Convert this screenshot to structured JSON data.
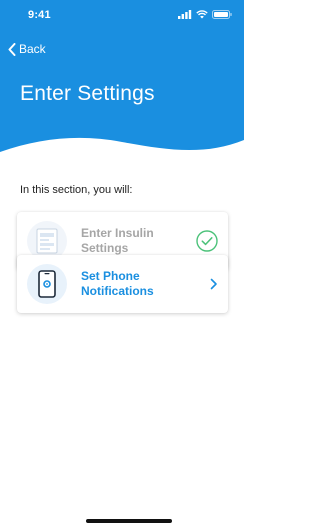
{
  "status_bar": {
    "time": "9:41"
  },
  "nav": {
    "back_label": "Back"
  },
  "header": {
    "title": "Enter Settings"
  },
  "intro_text": "In this section, you will:",
  "steps": [
    {
      "label_line1": "Enter Insulin",
      "label_line2": "Settings",
      "state": "completed",
      "icon": "document-form-icon",
      "trail_icon": "checkmark-circle-icon"
    },
    {
      "label_line1": "Set Phone",
      "label_line2": "Notifications",
      "state": "active",
      "icon": "phone-settings-icon",
      "trail_icon": "chevron-right-icon"
    }
  ],
  "colors": {
    "brand_blue": "#1a8fe0",
    "success_green": "#4cc27a",
    "disabled_text": "#a6a6a6"
  }
}
